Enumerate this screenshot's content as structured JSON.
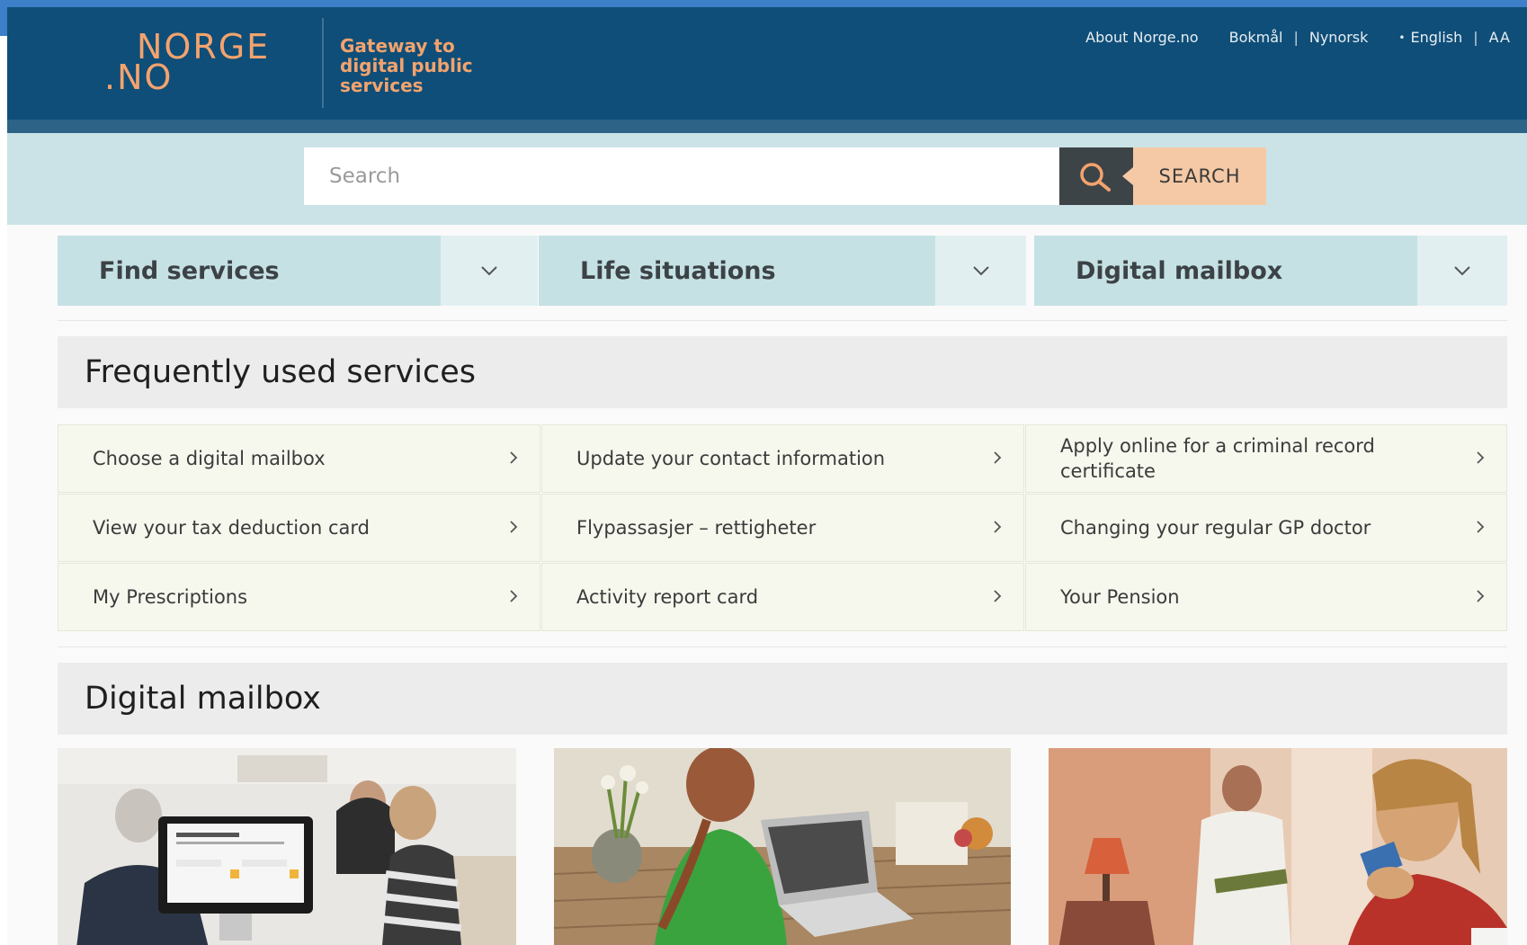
{
  "header": {
    "logo_line1": "NORGE",
    "logo_line2": ".NO",
    "tagline": "Gateway to digital public services",
    "nav": {
      "about": "About Norge.no",
      "bokmal": "Bokmål",
      "nynorsk": "Nynorsk",
      "english": "English",
      "text_size": "AA",
      "separator": "|",
      "bullet": "•"
    }
  },
  "search": {
    "placeholder": "Search",
    "button_label": "SEARCH"
  },
  "tabs": [
    {
      "label": "Find services"
    },
    {
      "label": "Life situations"
    },
    {
      "label": "Digital mailbox"
    }
  ],
  "frequent": {
    "title": "Frequently used services",
    "items": [
      {
        "label": "Choose a digital mailbox"
      },
      {
        "label": "Update your contact information"
      },
      {
        "label": "Apply online for a criminal record certificate"
      },
      {
        "label": "View your tax deduction card"
      },
      {
        "label": "Flypassasjer – rettigheter"
      },
      {
        "label": "Changing your regular GP doctor"
      },
      {
        "label": "My Prescriptions"
      },
      {
        "label": "Activity report card"
      },
      {
        "label": "Your Pension"
      }
    ]
  },
  "mailbox": {
    "title": "Digital mailbox"
  },
  "colors": {
    "header_bg": "#0f4e78",
    "accent_orange": "#f3a36d",
    "search_band": "#cbe3e6",
    "tab_bg": "#c5e1e4",
    "cell_bg": "#f6f8ee"
  },
  "icons": [
    "search-icon",
    "chevron-down-icon",
    "chevron-right-icon"
  ]
}
